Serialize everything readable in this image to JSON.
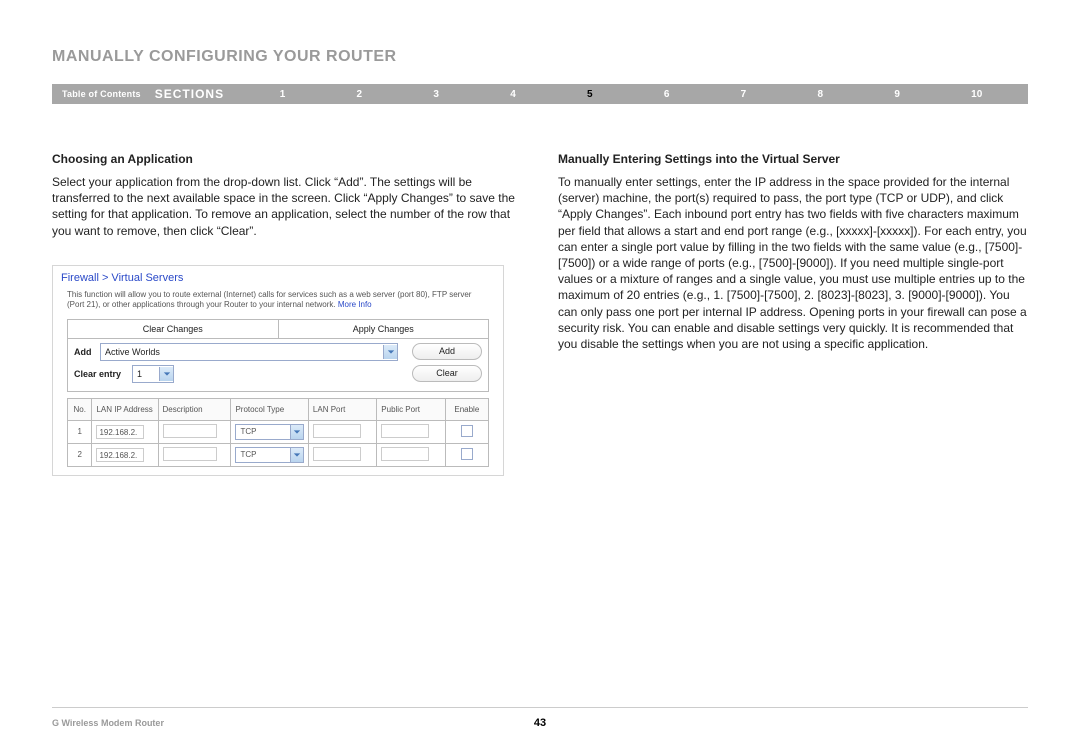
{
  "page_title": "MANUALLY CONFIGURING YOUR ROUTER",
  "nav": {
    "toc": "Table of Contents",
    "sections": "SECTIONS",
    "numbers": [
      "1",
      "2",
      "3",
      "4",
      "5",
      "6",
      "7",
      "8",
      "9",
      "10"
    ],
    "active_index": 4
  },
  "left": {
    "heading": "Choosing an Application",
    "body": "Select your application from the drop-down list. Click “Add”. The settings will be transferred to the next available space in the screen. Click “Apply Changes” to save the setting for that application. To remove an application, select the number of the row that you want to remove, then click “Clear”."
  },
  "right": {
    "heading": "Manually Entering Settings into the Virtual Server",
    "body": "To manually enter settings, enter the IP address in the space provided for the internal (server) machine, the port(s) required to pass, the port type (TCP or UDP), and click “Apply Changes”. Each inbound port entry has two fields with five characters maximum per field that allows a start and end port range (e.g., [xxxxx]-[xxxxx]). For each entry, you can enter a single port value by filling in the two fields with the same value (e.g., [7500]-[7500]) or a wide range of ports (e.g., [7500]-[9000]). If you need multiple single-port values or a mixture of ranges and a single value, you must use multiple entries up to the maximum of 20 entries (e.g., 1. [7500]-[7500], 2. [8023]-[8023], 3. [9000]-[9000]). You can only pass one port per internal IP address. Opening ports in your firewall can pose a security risk. You can enable and disable settings very quickly. It is recommended that you disable the settings when you are not using a specific application."
  },
  "shot": {
    "breadcrumb": "Firewall > Virtual Servers",
    "desc": "This function will allow you to route external (Internet) calls for services such as a web server (port 80), FTP server (Port 21), or other applications through your Router to your internal network.",
    "more": "More Info",
    "clear_changes": "Clear Changes",
    "apply_changes": "Apply Changes",
    "add_label": "Add",
    "add_value": "Active Worlds",
    "add_btn": "Add",
    "clear_entry_label": "Clear entry",
    "clear_entry_value": "1",
    "clear_btn": "Clear",
    "columns": {
      "no": "No.",
      "ip": "LAN IP Address",
      "desc": "Description",
      "proto": "Protocol Type",
      "lan_port": "LAN Port",
      "pub_port": "Public Port",
      "enable": "Enable"
    },
    "rows": [
      {
        "no": "1",
        "ip": "192.168.2.",
        "proto": "TCP"
      },
      {
        "no": "2",
        "ip": "192.168.2.",
        "proto": "TCP"
      }
    ]
  },
  "footer": {
    "product": "G Wireless Modem Router",
    "page": "43"
  }
}
